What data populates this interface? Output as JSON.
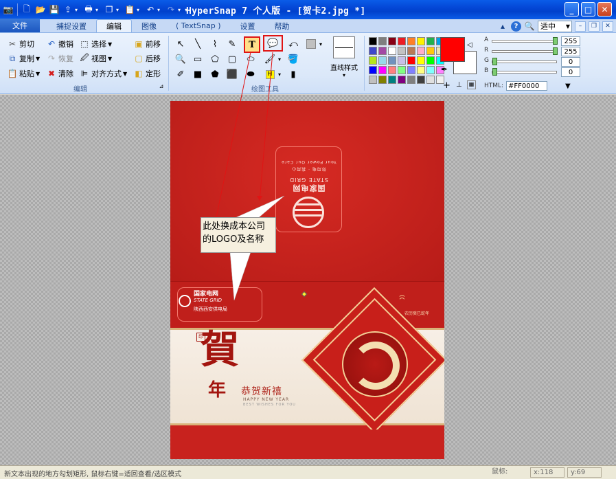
{
  "window": {
    "title": "HyperSnap 7 个人版 - [贺卡2.jpg *]",
    "quick_access": [
      "app-icon",
      "new-icon",
      "open-icon",
      "save-icon",
      "upload-icon",
      "print-icon",
      "window-icon",
      "paste-icon",
      "undo-icon",
      "redo-icon"
    ]
  },
  "tabs": {
    "file": "文件",
    "items": [
      "捕捉设置",
      "编辑",
      "图像",
      "( TextSnap )",
      "设置",
      "帮助"
    ],
    "active": "编辑",
    "zoom": "适中"
  },
  "edit_group": {
    "label": "编辑",
    "cut": "剪切",
    "undo": "撤销",
    "select": "选择",
    "copy": "复制",
    "redo": "恢复",
    "view": "视图",
    "paste": "粘贴",
    "clear": "清除",
    "align": "对齐方式",
    "bring_forward": "前移",
    "send_back": "后移",
    "shape_menu": "定形"
  },
  "draw_group": {
    "label": "绘图工具",
    "line_style": "直线样式"
  },
  "color_panel": {
    "current_color": "#ff0000",
    "channels": [
      {
        "label": "A",
        "value": "255",
        "fraction": 1.0
      },
      {
        "label": "R",
        "value": "255",
        "fraction": 1.0
      },
      {
        "label": "G",
        "value": "0",
        "fraction": 0.0
      },
      {
        "label": "B",
        "value": "0",
        "fraction": 0.0
      }
    ],
    "html_label": "HTML:",
    "html_value": "#FF0000",
    "palette": [
      "#000000",
      "#7f7f7f",
      "#880015",
      "#ed1c24",
      "#ff7f27",
      "#fff200",
      "#22b14c",
      "#00a2e8",
      "#3f48cc",
      "#a349a4",
      "#ffffff",
      "#c3c3c3",
      "#b97a57",
      "#ffaec9",
      "#ffc90e",
      "#efe4b0",
      "#b5e61d",
      "#99d9ea",
      "#7092be",
      "#c8bfe7",
      "#ff0000",
      "#ffff00",
      "#00ff00",
      "#00ffff",
      "#0000ff",
      "#ff00ff",
      "#ff8080",
      "#80ff80",
      "#8080ff",
      "#ffff80",
      "#80ffff",
      "#ff80ff",
      "#c0c0c0",
      "#808000",
      "#008080",
      "#800080",
      "#808080",
      "#404040",
      "#e0e0e0",
      "#f0f0f0"
    ]
  },
  "canvas": {
    "callout_text_line1": "此处换成本公司",
    "callout_text_line2": "的LOGO及名称",
    "top_logo_cn": "国家电网",
    "top_logo_en": "STATE GRID",
    "top_logo_slogan": "你用电 · 我用心",
    "top_logo_slogan_en": "Your Power Our Care",
    "logo2_cn": "国家电网",
    "logo2_en": "STATE GRID",
    "logo2_branch": "陕西西安供电局",
    "zodiac_text": "农历癸巳蛇年",
    "he_char": "賀",
    "nian_char": "年",
    "greeting": "恭贺新禧",
    "happy_new_year": "HAPPY NEW YEAR",
    "best_wishes": "BEST WISHES FOR YOU"
  },
  "status": {
    "hint": "新文本出现的地方勾划矩形, 鼠标右键=适回查看/选区模式",
    "mouse_label": "鼠标:",
    "x": "x:118",
    "y": "y:69"
  }
}
